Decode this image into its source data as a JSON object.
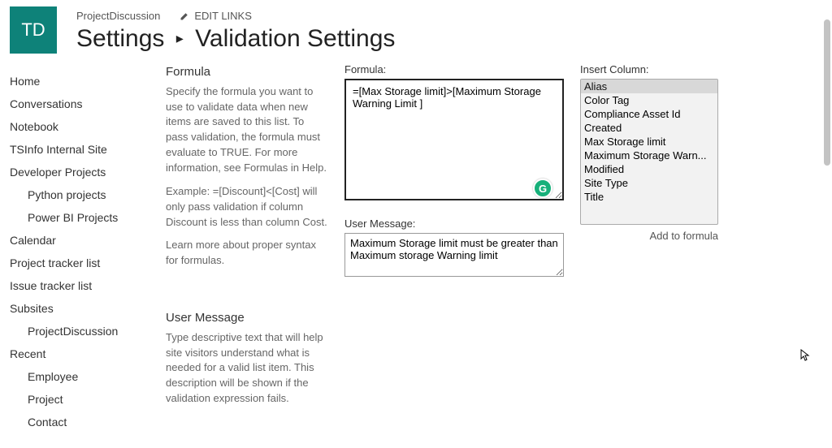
{
  "header": {
    "site_logo_text": "TD",
    "site_name": "ProjectDiscussion",
    "edit_links_label": "EDIT LINKS",
    "breadcrumb_settings": "Settings",
    "breadcrumb_page": "Validation Settings"
  },
  "sidebar": {
    "items": [
      {
        "label": "Home",
        "sub": false
      },
      {
        "label": "Conversations",
        "sub": false
      },
      {
        "label": "Notebook",
        "sub": false
      },
      {
        "label": "TSInfo Internal Site",
        "sub": false
      },
      {
        "label": "Developer Projects",
        "sub": false
      },
      {
        "label": "Python projects",
        "sub": true
      },
      {
        "label": "Power BI Projects",
        "sub": true
      },
      {
        "label": "Calendar",
        "sub": false
      },
      {
        "label": "Project tracker list",
        "sub": false
      },
      {
        "label": "Issue tracker list",
        "sub": false
      },
      {
        "label": "Subsites",
        "sub": false
      },
      {
        "label": "ProjectDiscussion",
        "sub": true
      },
      {
        "label": "Recent",
        "sub": false
      },
      {
        "label": "Employee",
        "sub": true
      },
      {
        "label": "Project",
        "sub": true
      },
      {
        "label": "Contact",
        "sub": true
      }
    ]
  },
  "descriptions": {
    "formula_heading": "Formula",
    "formula_p1": "Specify the formula you want to use to validate data when new items are saved to this list. To pass validation, the formula must evaluate to TRUE. For more information, see Formulas in Help.",
    "formula_p2": "Example: =[Discount]<[Cost] will only pass validation if column Discount is less than column Cost.",
    "formula_p3": "Learn more about proper syntax for formulas.",
    "usermsg_heading": "User Message",
    "usermsg_p1": "Type descriptive text that will help site visitors understand what is needed for a valid list item. This description will be shown if the validation expression fails."
  },
  "form": {
    "formula_label": "Formula:",
    "formula_value": "=[Max Storage limit]>[Maximum Storage Warning Limit ]",
    "insert_label": "Insert Column:",
    "columns": [
      "Alias",
      "Color Tag",
      "Compliance Asset Id",
      "Created",
      "Max Storage limit",
      "Maximum Storage Warn...",
      "Modified",
      "Site Type",
      "Title"
    ],
    "add_to_formula": "Add to formula",
    "usermsg_label": "User Message:",
    "usermsg_value": "Maximum Storage limit must be greater than Maximum storage Warning limit"
  }
}
